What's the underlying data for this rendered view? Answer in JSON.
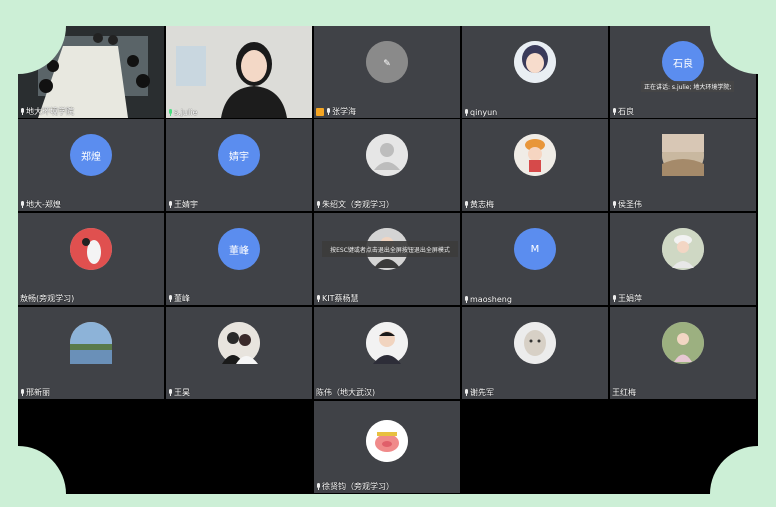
{
  "speaking_label": "正在讲话: s.julie; 地大环境学院;",
  "esc_hint": "按ESC键或者点击退出全屏按钮退出全屏模式",
  "participants": [
    {
      "name": "地大环境学院",
      "kind": "video-room"
    },
    {
      "name": "s.julie",
      "kind": "video-person"
    },
    {
      "name": "张学海",
      "kind": "photo-logo"
    },
    {
      "name": "qinyun",
      "kind": "photo"
    },
    {
      "name": "石良",
      "kind": "text",
      "initials": "石良"
    },
    {
      "name": "地大-郑煌",
      "kind": "text",
      "initials": "郑煌"
    },
    {
      "name": "王婧宇",
      "kind": "text",
      "initials": "婧宇"
    },
    {
      "name": "朱绍文（旁观学习）",
      "kind": "photo-default"
    },
    {
      "name": "黄志梅",
      "kind": "photo"
    },
    {
      "name": "侯圣伟",
      "kind": "photo"
    },
    {
      "name": "敖畅(旁观学习)",
      "kind": "photo"
    },
    {
      "name": "董峰",
      "kind": "text",
      "initials": "董峰"
    },
    {
      "name": "KIT蔡杨慧",
      "kind": "photo"
    },
    {
      "name": "maosheng",
      "kind": "text",
      "initials": "M"
    },
    {
      "name": "王娟萍",
      "kind": "photo"
    },
    {
      "name": "邢新丽",
      "kind": "photo"
    },
    {
      "name": "王昊",
      "kind": "photo"
    },
    {
      "name": "陈伟（地大武汉)",
      "kind": "photo"
    },
    {
      "name": "谢先军",
      "kind": "photo"
    },
    {
      "name": "王红梅",
      "kind": "photo"
    },
    {
      "name": "徐贤钧（旁观学习）",
      "kind": "photo"
    }
  ]
}
